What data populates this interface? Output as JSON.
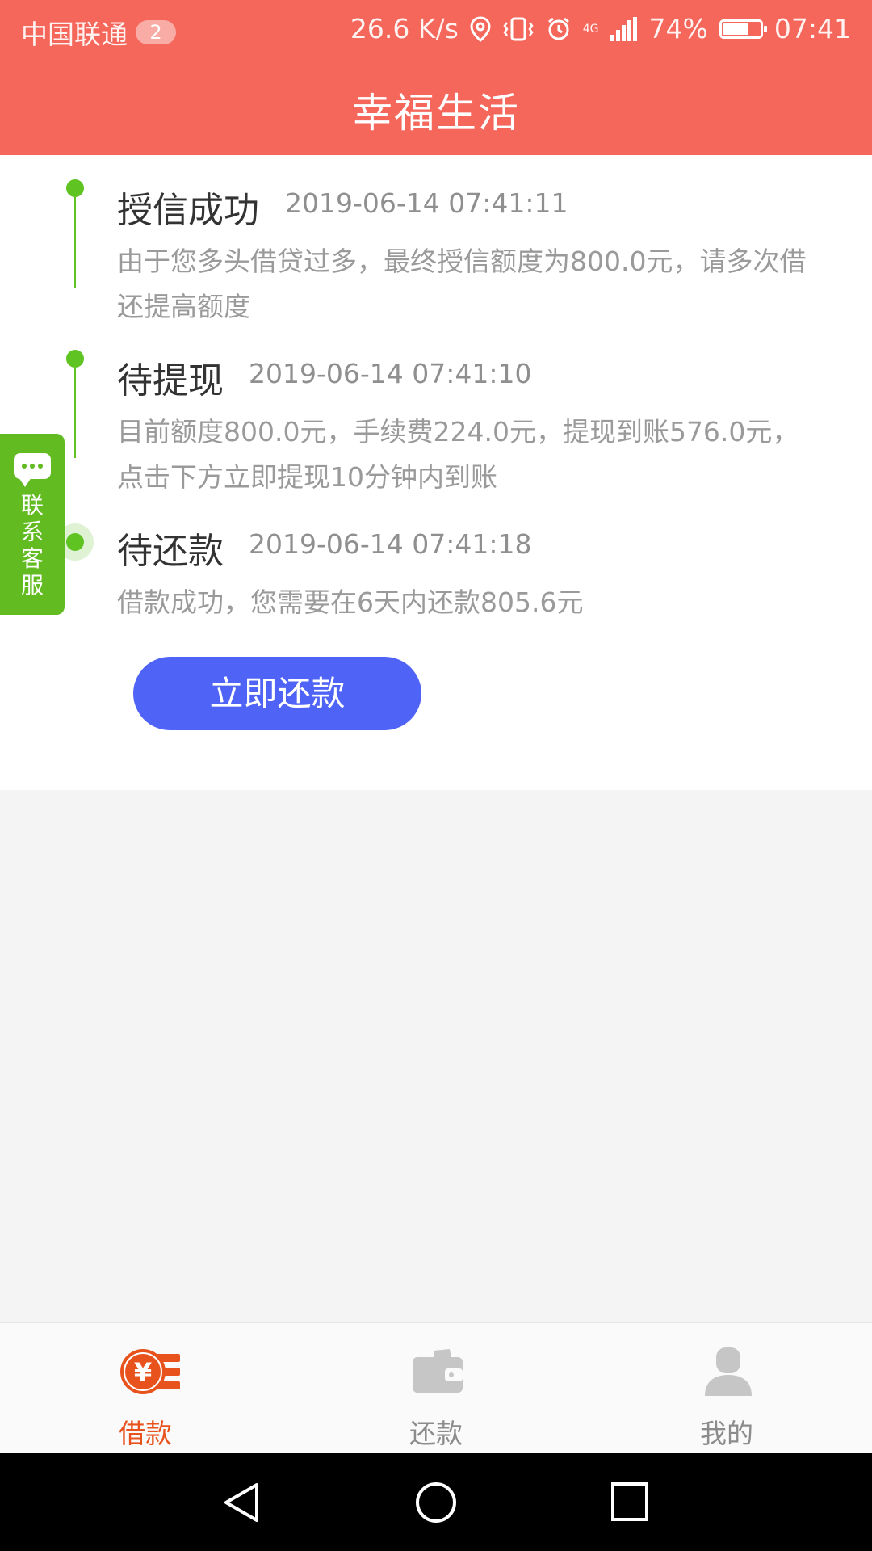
{
  "status_bar": {
    "carrier": "中国联通",
    "sim_badge": "2",
    "net_speed": "26.6 K/s",
    "network": "4G",
    "battery": "74%",
    "time": "07:41"
  },
  "header": {
    "title": "幸福生活"
  },
  "timeline": [
    {
      "title": "授信成功",
      "time": "2019-06-14 07:41:11",
      "desc": "由于您多头借贷过多，最终授信额度为800.0元，请多次借还提高额度"
    },
    {
      "title": "待提现",
      "time": "2019-06-14 07:41:10",
      "desc": "目前额度800.0元，手续费224.0元，提现到账576.0元，点击下方立即提现10分钟内到账"
    },
    {
      "title": "待还款",
      "time": "2019-06-14 07:41:18",
      "desc": "借款成功，您需要在6天内还款805.6元"
    }
  ],
  "repay_button": "立即还款",
  "support": {
    "label": "联系客服"
  },
  "tabs": [
    {
      "label": "借款",
      "icon": "loan-icon",
      "active": true
    },
    {
      "label": "还款",
      "icon": "wallet-icon",
      "active": false
    },
    {
      "label": "我的",
      "icon": "profile-icon",
      "active": false
    }
  ],
  "colors": {
    "header": "#f5665b",
    "timeline_green": "#5fc322",
    "button_blue": "#4f63f7",
    "active_tab": "#e8531d",
    "support_green": "#61bb21"
  }
}
